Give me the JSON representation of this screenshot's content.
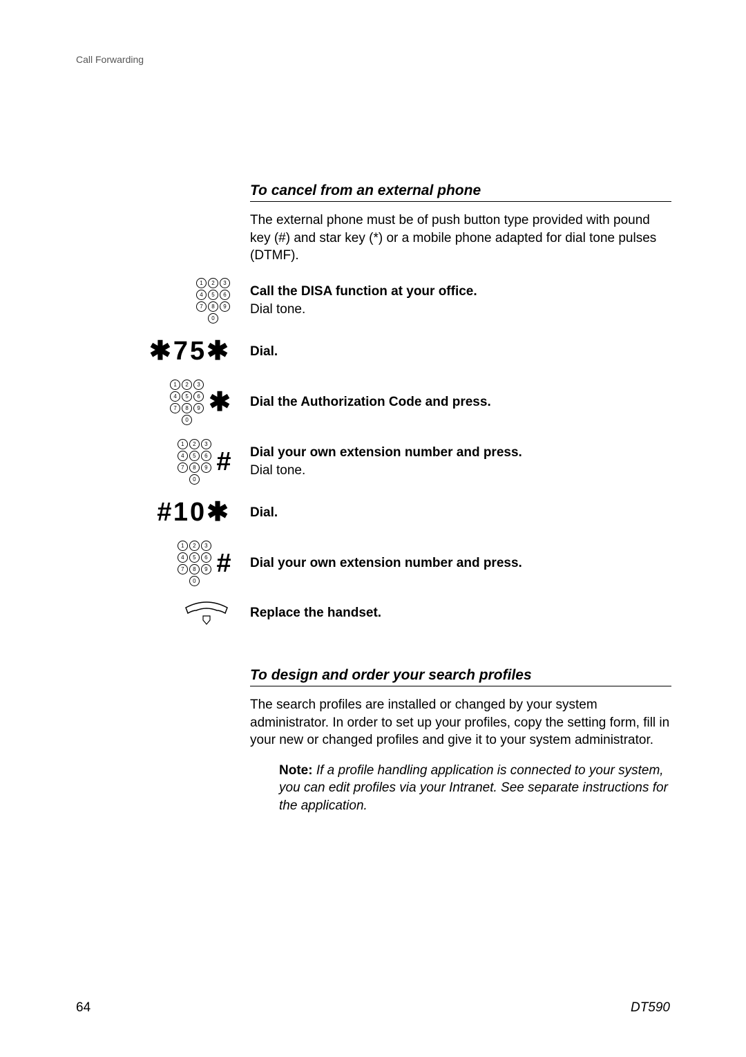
{
  "header": "Call Forwarding",
  "section1": {
    "title": "To cancel from an external phone",
    "intro": "The external phone must be of push button type provided with pound key (#) and star key (*) or a mobile phone adapted for dial tone pulses (DTMF).",
    "steps": [
      {
        "icon": "keypad",
        "bold": "Call the DISA function at your office.",
        "plain": "Dial tone."
      },
      {
        "icon": "code",
        "code": "*75*",
        "bold": "Dial."
      },
      {
        "icon": "keypad-star",
        "bold": "Dial the Authorization Code and press."
      },
      {
        "icon": "keypad-hash",
        "bold": "Dial your own extension number and press.",
        "plain": "Dial tone."
      },
      {
        "icon": "code",
        "code": "#10*",
        "bold": "Dial."
      },
      {
        "icon": "keypad-hash",
        "bold": "Dial your own extension number and press."
      },
      {
        "icon": "handset",
        "bold": "Replace the handset."
      }
    ]
  },
  "section2": {
    "title": "To design and order your search profiles",
    "intro": "The search profiles are installed or changed by your system administrator. In order to set up your profiles, copy the setting form, fill in your new or changed profiles and give it to your system administrator.",
    "note_label": "Note:",
    "note_body": "If a profile handling application is connected to your system, you can edit profiles via your Intranet. See separate instructions for the application."
  },
  "footer": {
    "page": "64",
    "model": "DT590"
  }
}
